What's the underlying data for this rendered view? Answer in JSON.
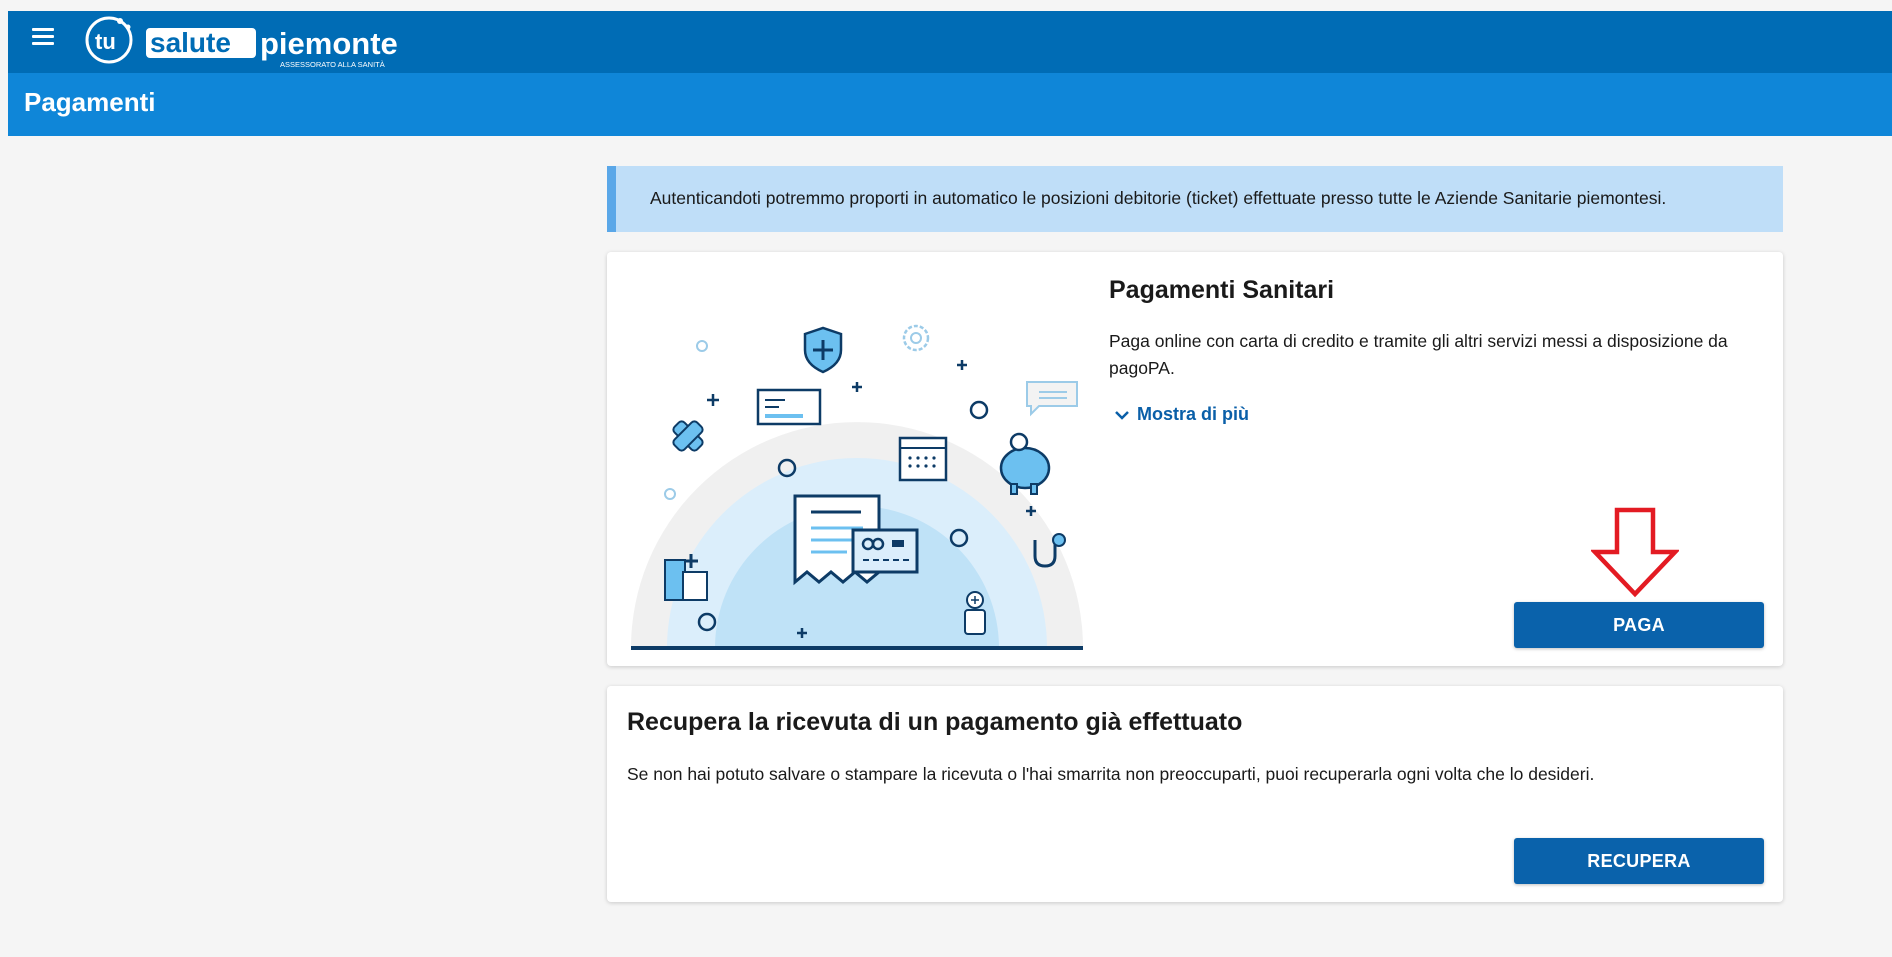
{
  "header": {
    "logo_tu": "tu",
    "logo_salute": "salute",
    "logo_piemonte": "piemonte",
    "logo_sub": "ASSESSORATO ALLA SANITÀ",
    "brand_color": "#006cb5"
  },
  "page": {
    "title": "Pagamenti"
  },
  "banner": {
    "text": "Autenticandoti potremmo proporti in automatico le posizioni debitorie (ticket) effettuate presso tutte le Aziende Sanitarie piemontesi."
  },
  "card_payments": {
    "title": "Pagamenti Sanitari",
    "description": "Paga online con carta di credito e tramite gli altri servizi messi a disposizione da pagoPA.",
    "show_more": "Mostra di più",
    "button": "PAGA"
  },
  "card_receipt": {
    "title": "Recupera la ricevuta di un pagamento già effettuato",
    "description": "Se non hai potuto salvare o stampare la ricevuta o l'hai smarrita non preoccuparti, puoi recuperarla ogni volta che lo desideri.",
    "button": "RECUPERA"
  },
  "icons": {
    "menu": "hamburger-menu-icon",
    "chevron": "chevron-down-icon",
    "annotation": "red-down-arrow-icon"
  }
}
